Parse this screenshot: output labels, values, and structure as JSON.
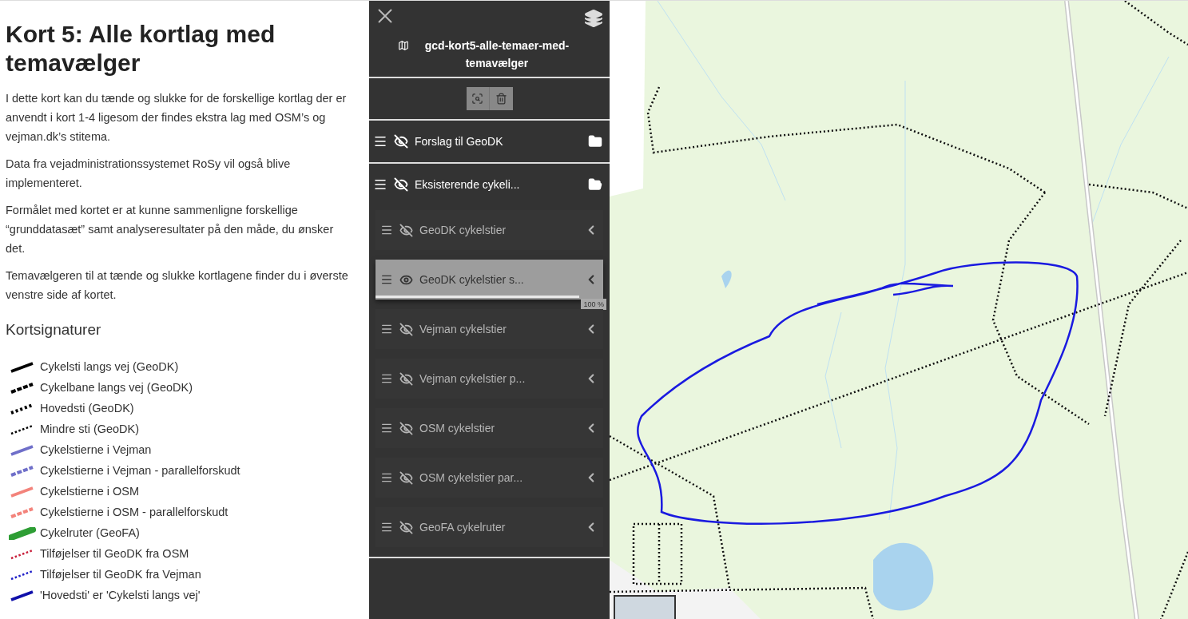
{
  "article": {
    "title": "Kort 5: Alle kortlag med temavælger",
    "paragraphs": [
      "I dette kort kan du tænde og slukke for de forskellige kortlag der er anvendt i kort 1-4 ligesom der findes ekstra lag med OSM’s og vejman.dk’s stitema.",
      "Data fra vejadministrationssystemet RoSy vil også blive implementeret.",
      "Formålet med kortet er at kunne sammenligne forskellige “grunddatasæt” samt analyseresultater på den måde, du ønsker det.",
      "Temavælgeren til at tænde og slukke kortlagene finder du i øverste venstre side af kortet."
    ],
    "legend_title": "Kortsignaturer",
    "legend": [
      {
        "label": "Cykelsti langs vej (GeoDK)",
        "kind": "solid",
        "color": "#000000"
      },
      {
        "label": "Cykelbane langs vej (GeoDK)",
        "kind": "dashed",
        "color": "#000000"
      },
      {
        "label": "Hovedsti (GeoDK)",
        "kind": "dotted",
        "color": "#000000"
      },
      {
        "label": "Mindre sti (GeoDK)",
        "kind": "fine",
        "color": "#000000"
      },
      {
        "label": "Cykelstierne i Vejman",
        "kind": "solid",
        "color": "#6f6fc9"
      },
      {
        "label": "Cykelstierne i Vejman - parallelforskudt",
        "kind": "dashed",
        "color": "#6f6fc9"
      },
      {
        "label": "Cykelstierne i OSM",
        "kind": "solid",
        "color": "#f3837b"
      },
      {
        "label": "Cykelstierne i OSM - parallelforskudt",
        "kind": "dashed",
        "color": "#f3837b"
      },
      {
        "label": "Cykelruter (GeoFA)",
        "kind": "thick",
        "color": "#2e9e35"
      },
      {
        "label": "Tilføjelser til GeoDK fra OSM",
        "kind": "fine",
        "color": "#c81e3a"
      },
      {
        "label": "Tilføjelser til GeoDK fra Vejman",
        "kind": "fine",
        "color": "#1e1ec8"
      },
      {
        "label": "'Hovedsti' er 'Cykelsti langs vej'",
        "kind": "solid",
        "color": "#1010aa"
      }
    ]
  },
  "layer_panel": {
    "title": "gcd-kort5-alle-temaer-med-temavælger",
    "groups": [
      {
        "label": "Forslag til GeoDK",
        "visible": false,
        "expanded": false
      },
      {
        "label": "Eksisterende cykeli...",
        "visible": false,
        "expanded": true,
        "children": [
          {
            "label": "GeoDK cykelstier",
            "visible": false,
            "selected": false
          },
          {
            "label": "GeoDK cykelstier s...",
            "visible": true,
            "selected": true,
            "opacity": {
              "level": 1,
              "reading": "100 %"
            }
          },
          {
            "label": "Vejman cykelstier",
            "visible": false,
            "selected": false
          },
          {
            "label": "Vejman cykelstier p...",
            "visible": false,
            "selected": false
          },
          {
            "label": "OSM cykelstier",
            "visible": false,
            "selected": false
          },
          {
            "label": "OSM cykelstier par...",
            "visible": false,
            "selected": false
          },
          {
            "label": "GeoFA cykelruter",
            "visible": false,
            "selected": false
          }
        ]
      }
    ]
  }
}
